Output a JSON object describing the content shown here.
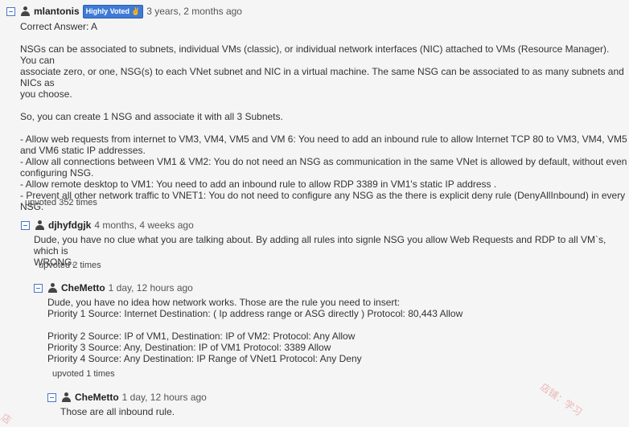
{
  "comments": [
    {
      "username": "mlantonis",
      "badge": "Highly Voted",
      "badge_icon": "thumbs-up-icon",
      "timestamp": "3 years, 2 months ago",
      "lines": [
        "Correct Answer: A",
        "",
        "NSGs can be associated to subnets, individual VMs (classic), or individual network interfaces (NIC) attached to VMs (Resource Manager). You can",
        "associate zero, or one, NSG(s) to each VNet subnet and NIC in a virtual machine. The same NSG can be associated to as many subnets and NICs as",
        "you choose.",
        "",
        "So, you can create 1 NSG and associate it with all 3 Subnets.",
        "",
        "- Allow web requests from internet to VM3, VM4, VM5 and VM 6: You need to add an inbound rule to allow Internet TCP 80 to VM3, VM4, VM5",
        "and VM6 static IP addresses.",
        "- Allow all connections between VM1 & VM2: You do not need an NSG as communication in the same VNet is allowed by default, without even",
        "configuring NSG.",
        "- Allow remote desktop to VM1: You need to add an inbound rule to allow RDP 3389 in VM1's static IP address .",
        "- Prevent all other network traffic to VNET1: You do not need to configure any NSG as the there is explicit deny rule (DenyAllInbound) in every",
        "NSG."
      ],
      "upvotes": "upvoted 352 times"
    },
    {
      "username": "djhyfdgjk",
      "timestamp": "4 months, 4 weeks ago",
      "lines": [
        "Dude, you have no clue what you are talking about. By adding all rules into signle NSG you allow Web Requests and RDP to all VM`s, which is",
        "WRONG."
      ],
      "upvotes": "upvoted 2 times"
    },
    {
      "username": "CheMetto",
      "timestamp": "1 day, 12 hours ago",
      "lines": [
        "Dude, you have no idea how network works. Those are the rule you need to insert:",
        "Priority 1 Source: Internet Destination: ( Ip address range or ASG directly ) Protocol: 80,443 Allow",
        "",
        "Priority 2 Source: IP of VM1, Destination: IP of VM2: Protocol: Any Allow",
        "Priority 3 Source: Any, Destination: IP of VM1 Protocol: 3389 Allow",
        "Priority 4 Source: Any Destination: IP Range of VNet1 Protocol: Any Deny"
      ],
      "upvotes": "upvoted 1 times"
    },
    {
      "username": "CheMetto",
      "timestamp": "1 day, 12 hours ago",
      "lines": [
        "Those are all inbound rule."
      ]
    }
  ],
  "watermark": {
    "text_right": "店铺：学习",
    "text_left": "店"
  },
  "colors": {
    "badge": "#3f7ad6",
    "toggle": "#4a76c8",
    "background": "#f5f5f5"
  }
}
